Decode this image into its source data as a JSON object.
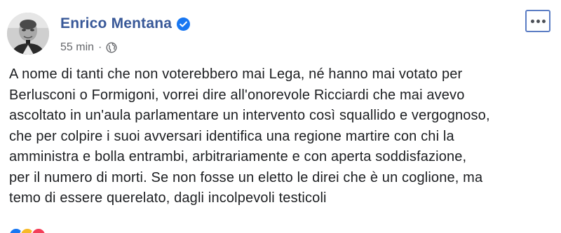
{
  "post": {
    "author": "Enrico Mentana",
    "verified_icon": "verified-badge-icon",
    "time": "55 min",
    "separator": "·",
    "audience_icon": "globe-icon",
    "more_icon": "more-options-icon",
    "text_lines": [
      "A nome di tanti che non voterebbero mai Lega, né hanno mai votato per",
      "Berlusconi o Formigoni, vorrei dire all'onorevole Ricciardi che mai avevo",
      "ascoltato in un'aula parlamentare un intervento così squallido e vergognoso,",
      "che per colpire i suoi avversari identifica una regione martire con chi la",
      "amministra e bolla entrambi, arbitrariamente e con aperta soddisfazione,",
      "per il numero di morti. Se non fosse un eletto le direi che è un coglione, ma",
      "temo di essere querelato, dagli incolpevoli testicoli"
    ],
    "reaction_icons": [
      "like-reaction-icon",
      "haha-reaction-icon",
      "love-reaction-icon"
    ]
  },
  "colors": {
    "author_blue": "#385898",
    "meta_gray": "#65676b",
    "text": "#1c1e21",
    "verified_blue": "#1877f2",
    "like_blue": "#1877f2",
    "haha_yellow": "#f7b928",
    "love_red": "#f33e58"
  }
}
